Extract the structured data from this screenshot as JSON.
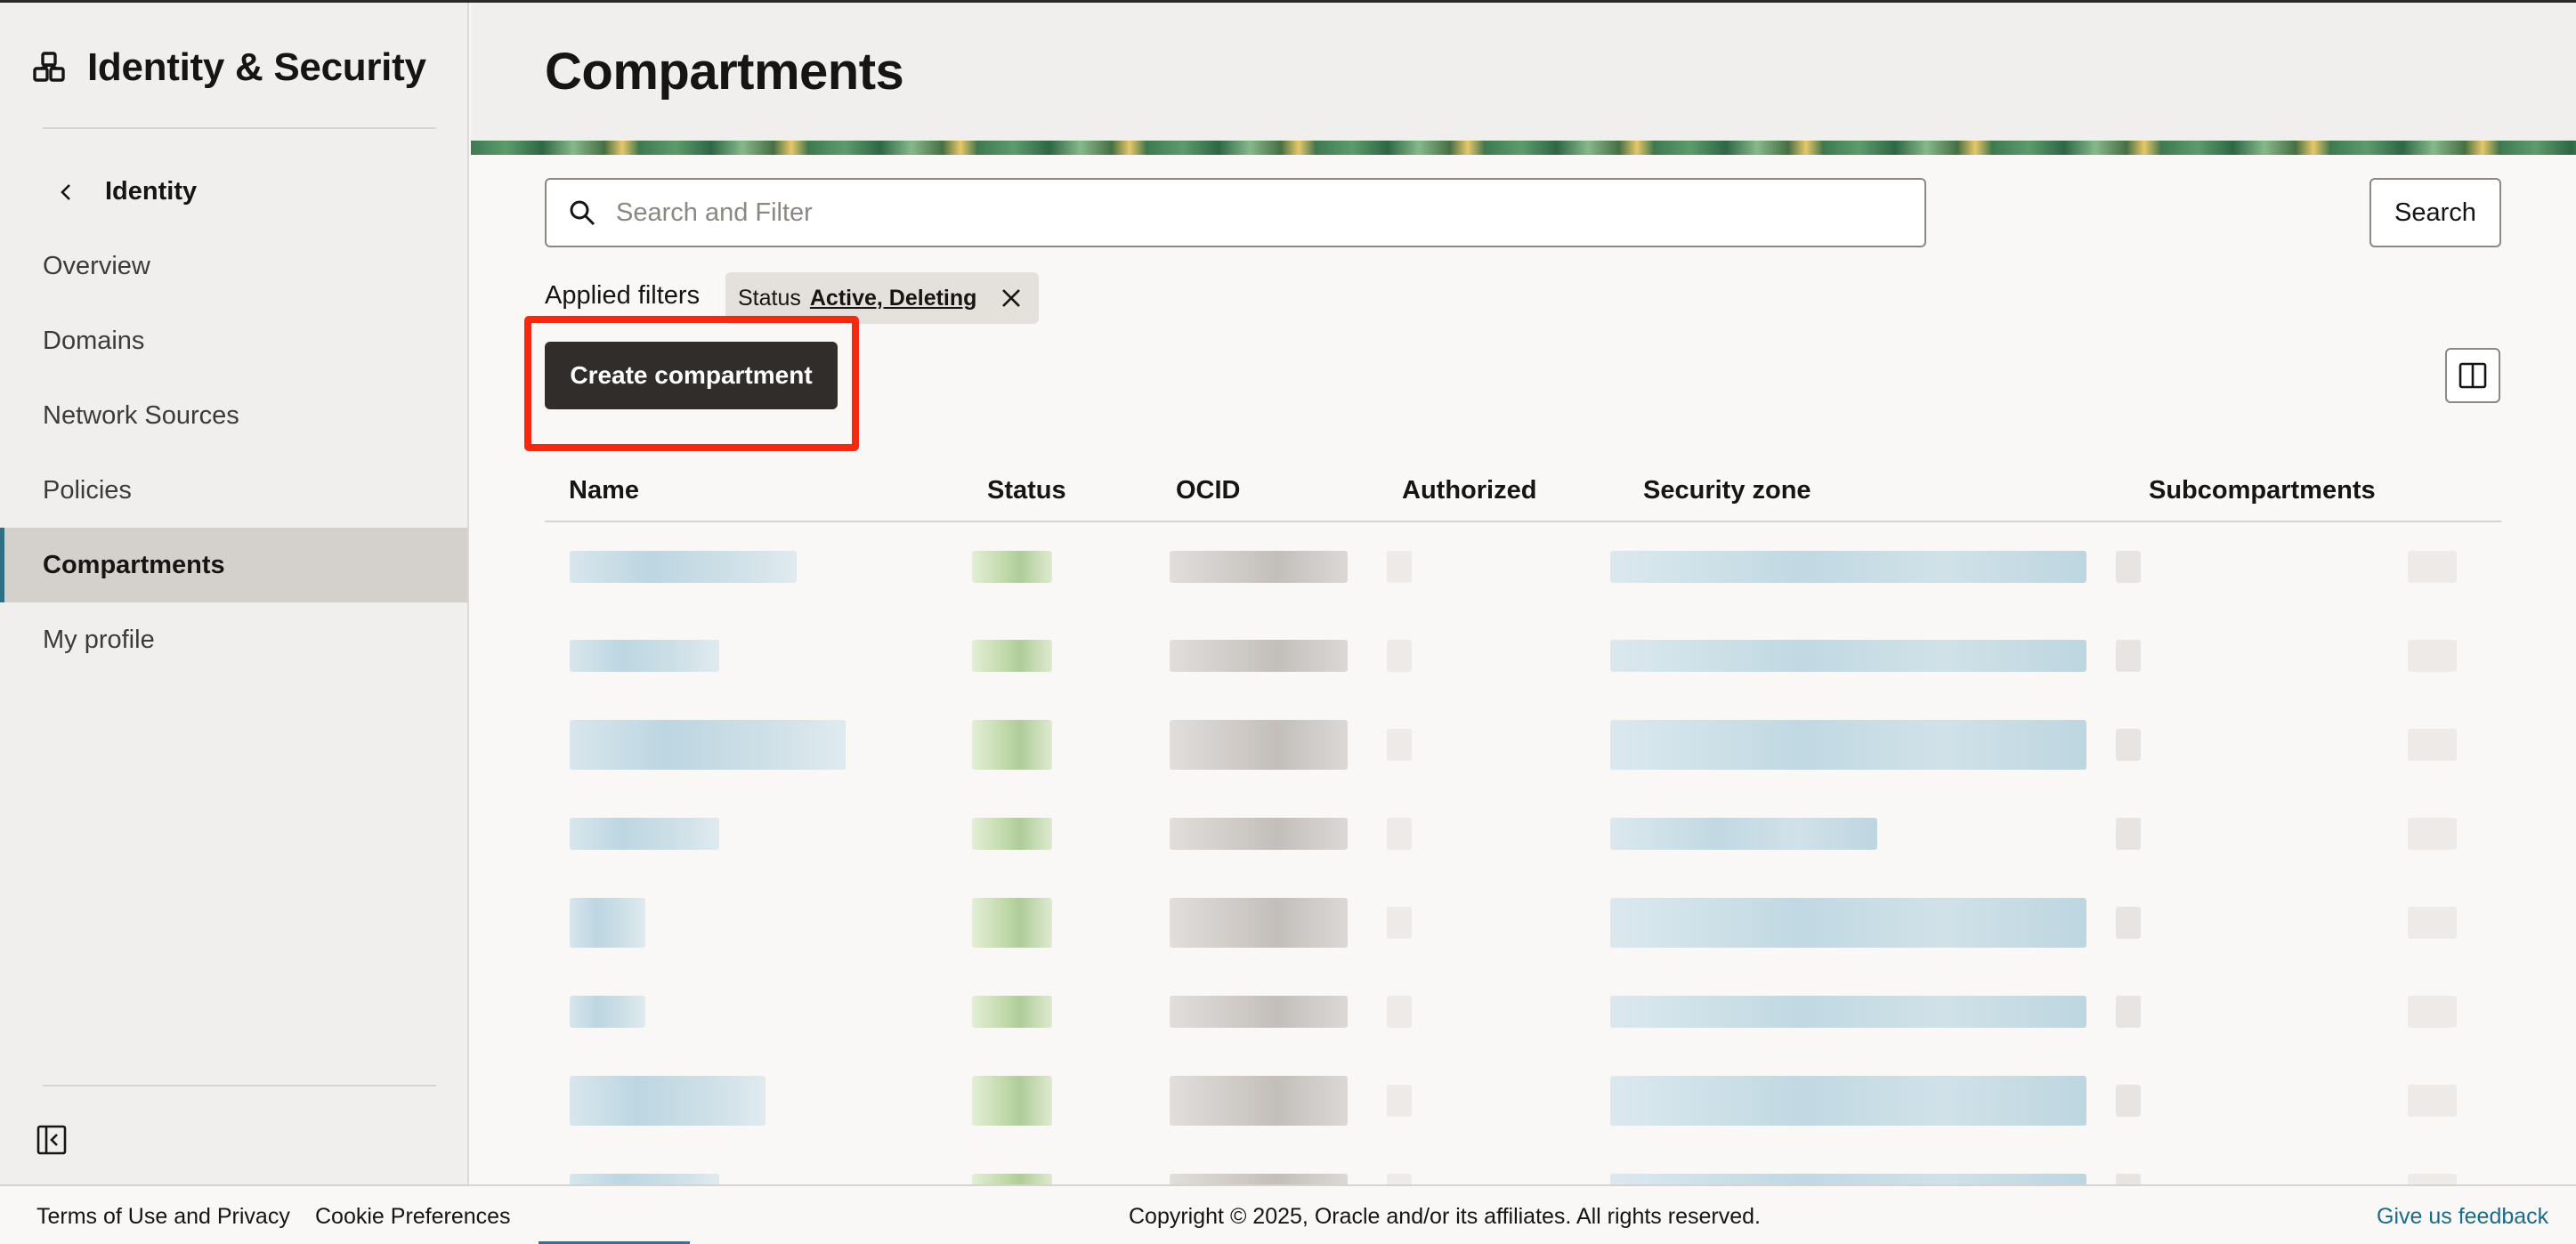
{
  "sidebar": {
    "title": "Identity & Security",
    "back_label": "Identity",
    "items": [
      {
        "label": "Overview"
      },
      {
        "label": "Domains"
      },
      {
        "label": "Network Sources"
      },
      {
        "label": "Policies"
      },
      {
        "label": "Compartments",
        "active": true
      },
      {
        "label": "My profile"
      }
    ]
  },
  "page": {
    "title": "Compartments"
  },
  "search": {
    "placeholder": "Search and Filter",
    "button_label": "Search"
  },
  "filters": {
    "label": "Applied filters",
    "chip_key": "Status",
    "chip_value": "Active, Deleting"
  },
  "actions": {
    "create_label": "Create compartment"
  },
  "table": {
    "columns": [
      "Name",
      "Status",
      "OCID",
      "Authorized",
      "Security zone",
      "Subcompartments"
    ],
    "row_count": 8,
    "note": "row contents are blurred/pixelated in the screenshot"
  },
  "footer": {
    "terms": "Terms of Use and Privacy",
    "cookies": "Cookie Preferences",
    "copyright": "Copyright © 2025, Oracle and/or its affiliates. All rights reserved.",
    "feedback": "Give us feedback"
  },
  "colors": {
    "accent_active": "#2f6f86",
    "primary_button": "#312d2a",
    "highlight_box": "#f42a10",
    "link": "#1c6b8a"
  }
}
